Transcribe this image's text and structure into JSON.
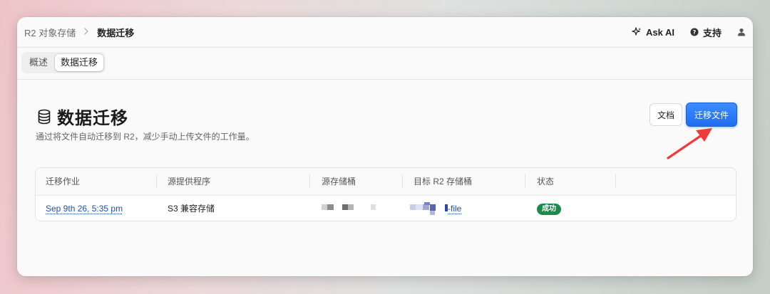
{
  "breadcrumb": {
    "parent": "R2 对象存储",
    "current": "数据迁移"
  },
  "top_actions": {
    "ask_ai": "Ask AI",
    "support": "支持"
  },
  "tabs": [
    {
      "label": "概述",
      "active": false
    },
    {
      "label": "数据迁移",
      "active": true
    }
  ],
  "page": {
    "title": "数据迁移",
    "description": "通过将文件自动迁移到 R2，减少手动上传文件的工作量。",
    "docs_button": "文档",
    "primary_button": "迁移文件"
  },
  "table": {
    "headers": [
      "迁移作业",
      "源提供程序",
      "源存储桶",
      "目标 R2 存储桶",
      "状态"
    ],
    "rows": [
      {
        "job": "Sep 9th 26, 5:35 pm",
        "provider": "S3 兼容存储",
        "source_bucket": "",
        "target_bucket_suffix": "-file",
        "status": "成功"
      }
    ]
  },
  "colors": {
    "accent": "#1f6df0",
    "success": "#1a8a4d",
    "annotation_arrow": "#ee3b3b",
    "link": "#1e4fa3"
  },
  "icons": {
    "ask_ai": "sparkle-icon",
    "support": "help-circle-icon",
    "user": "user-icon",
    "title": "database-icon",
    "breadcrumb_sep": "chevron-right-icon"
  }
}
